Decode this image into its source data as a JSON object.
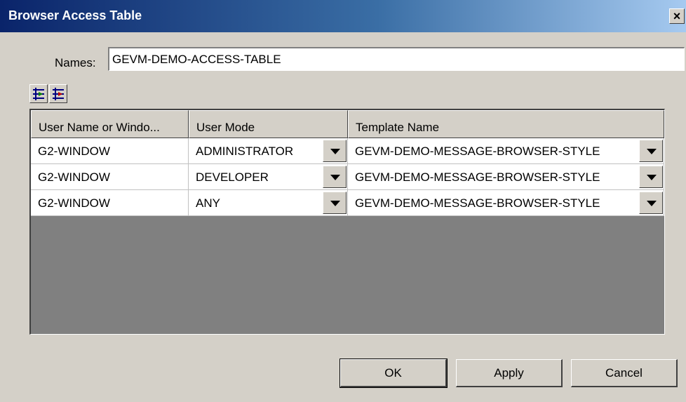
{
  "window": {
    "title": "Browser Access Table",
    "close_glyph": "×"
  },
  "names": {
    "label": "Names:",
    "value": "GEVM-DEMO-ACCESS-TABLE"
  },
  "toolbar": {
    "icons": [
      "add-row-icon",
      "delete-row-icon"
    ]
  },
  "table": {
    "columns": [
      "User Name or Windo...",
      "User Mode",
      "Template Name"
    ],
    "rows": [
      {
        "user": "G2-WINDOW",
        "mode": "ADMINISTRATOR",
        "template": "GEVM-DEMO-MESSAGE-BROWSER-STYLE"
      },
      {
        "user": "G2-WINDOW",
        "mode": "DEVELOPER",
        "template": "GEVM-DEMO-MESSAGE-BROWSER-STYLE"
      },
      {
        "user": "G2-WINDOW",
        "mode": "ANY",
        "template": "GEVM-DEMO-MESSAGE-BROWSER-STYLE"
      }
    ]
  },
  "buttons": {
    "ok": "OK",
    "apply": "Apply",
    "cancel": "Cancel"
  },
  "colors": {
    "titlebar_start": "#0a246a",
    "titlebar_end": "#a6caf0",
    "dialog_bg": "#d4d0c8",
    "grid_bg": "#808080"
  }
}
